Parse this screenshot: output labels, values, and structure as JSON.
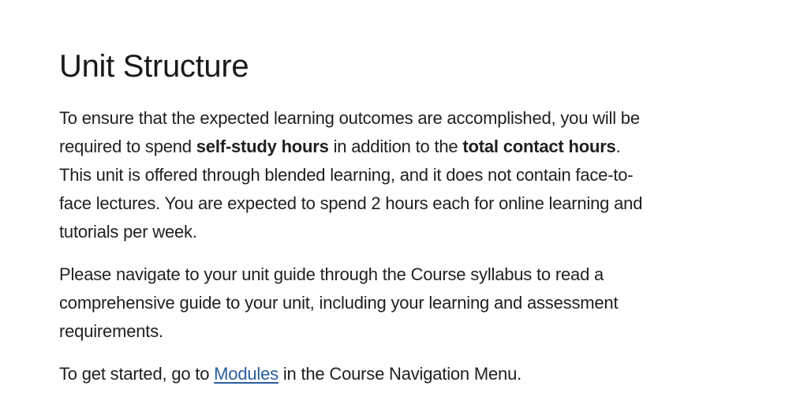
{
  "page": {
    "title": "Unit Structure",
    "paragraph1": {
      "t1": "To ensure that the expected learning outcomes are accomplished, you will be required to spend ",
      "b1": "self-study hours",
      "t2": " in addition to the ",
      "b2": "total contact hours",
      "t3": ". This unit is offered through blended learning, and it does not contain face-to-face lectures. You are expected to spend 2 hours each for online learning and tutorials per week."
    },
    "paragraph2": "Please navigate to your unit guide through the Course syllabus to read a comprehensive guide to your unit, including your learning and assessment requirements.",
    "paragraph3": {
      "t1": "To get started, go to ",
      "link": "Modules",
      "t2": " in the Course Navigation Menu."
    }
  },
  "colors": {
    "link": "#2a5d9e",
    "text": "#1f1f1f",
    "background": "#ffffff"
  }
}
